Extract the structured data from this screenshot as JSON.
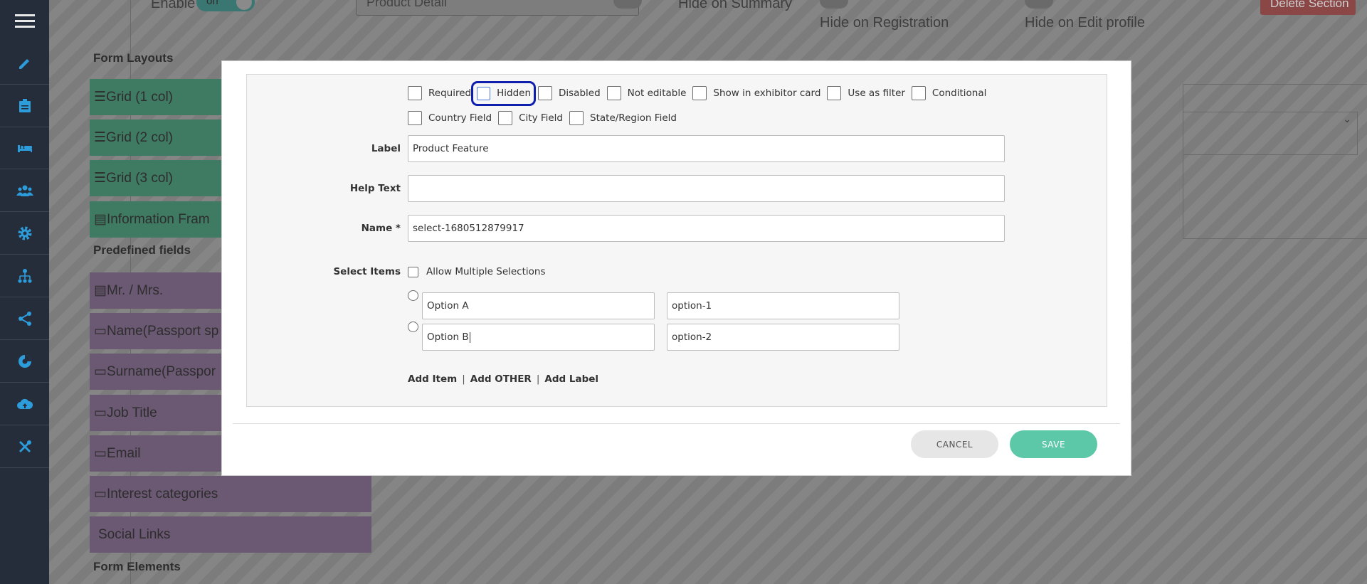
{
  "background": {
    "enable_label": "Enable",
    "enable_toggle": "on",
    "section_title_value": "Product Detail",
    "hide_on_summary": "Hide on Summary",
    "hide_on_registration": "Hide on Registration",
    "hide_on_edit_profile": "Hide on Edit profile",
    "delete_section": "Delete Section",
    "form_layouts_heading": "Form Layouts",
    "layouts": [
      "Grid (1 col)",
      "Grid (2 col)",
      "Grid (3 col)",
      "Information Fram"
    ],
    "predefined_heading": "Predefined fields",
    "predefined": [
      "Mr. / Mrs.",
      "Name(Passport sp",
      "Surname(Passpor",
      "Job Title",
      "Email",
      "Interest categories",
      "Social Links"
    ],
    "form_elements_heading": "Form Elements"
  },
  "sidebar": {
    "icons": [
      "menu-icon",
      "pencil-icon",
      "clipboard-icon",
      "bed-icon",
      "users-icon",
      "gear-icon",
      "sitemap-icon",
      "share-icon",
      "chart-icon",
      "cloud-upload-icon",
      "tools-icon"
    ]
  },
  "modal": {
    "options_row1": [
      "Required",
      "Hidden",
      "Disabled",
      "Not editable",
      "Show in exhibitor card",
      "Use as filter",
      "Conditional"
    ],
    "options_row2": [
      "Country Field",
      "City Field",
      "State/Region Field"
    ],
    "label_label": "Label",
    "label_value": "Product Feature",
    "help_text_label": "Help Text",
    "help_text_value": "",
    "name_label": "Name *",
    "name_value": "select-1680512879917",
    "select_items_label": "Select Items",
    "allow_multiple_label": "Allow Multiple Selections",
    "items": [
      {
        "label": "Option A",
        "value": "option-1"
      },
      {
        "label": "Option B",
        "value": "option-2"
      }
    ],
    "add_item": "Add Item",
    "add_other": "Add OTHER",
    "add_label": "Add Label",
    "separator": "|",
    "cancel": "CANCEL",
    "save": "SAVE"
  }
}
